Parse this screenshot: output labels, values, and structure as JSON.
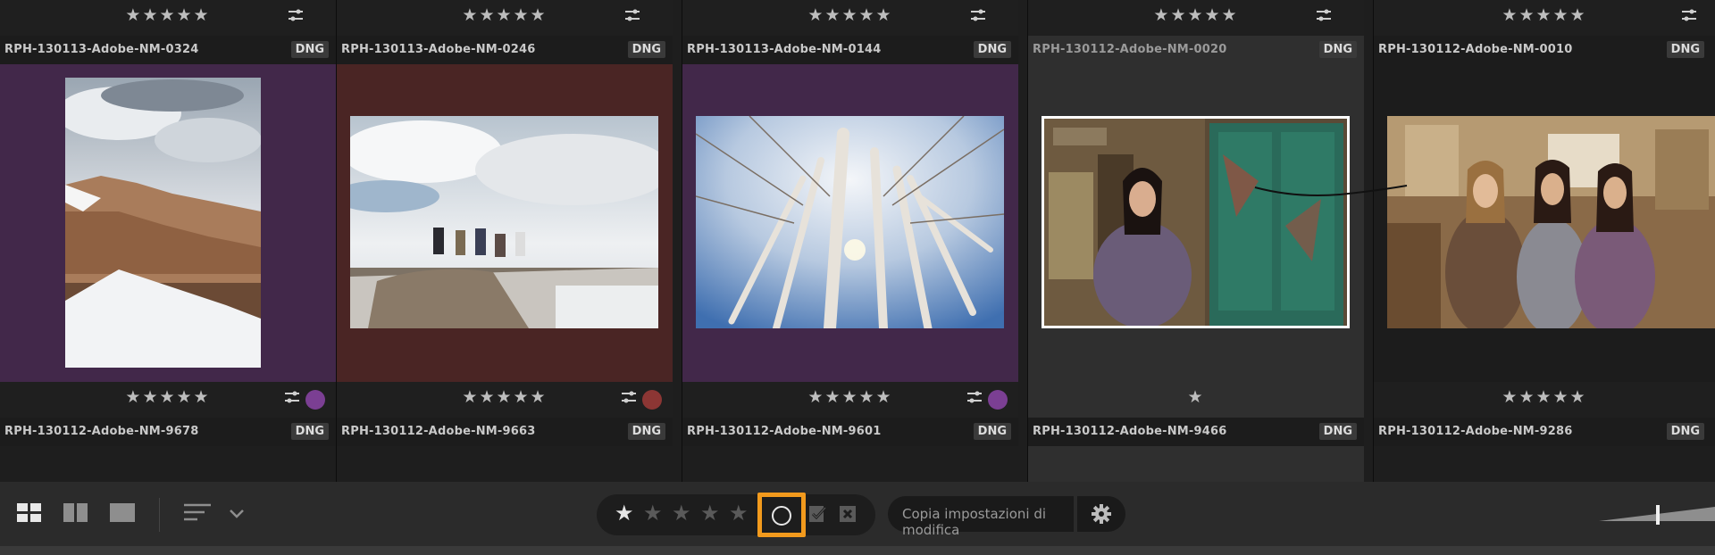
{
  "rows": [
    {
      "cells": [
        {
          "name": "RPH-130113-Adobe-NM-0324",
          "type": "DNG",
          "bg": "#42284a",
          "rating": 5,
          "label_color": "#7b3f93"
        },
        {
          "name": "RPH-130113-Adobe-NM-0246",
          "type": "DNG",
          "bg": "#4a2524",
          "rating": 5,
          "label_color": "#8c3634"
        },
        {
          "name": "RPH-130113-Adobe-NM-0144",
          "type": "DNG",
          "bg": "#42284a",
          "rating": 5,
          "label_color": "#7b3f93"
        },
        {
          "name": "RPH-130112-Adobe-NM-0020",
          "type": "DNG",
          "bg": "#2f2f2f",
          "rating": 1,
          "label_color": ""
        },
        {
          "name": "RPH-130112-Adobe-NM-0010",
          "type": "DNG",
          "bg": "#1c1c1c",
          "rating": 5,
          "label_color": ""
        }
      ]
    },
    {
      "cells": [
        {
          "name": "RPH-130112-Adobe-NM-9678",
          "type": "DNG"
        },
        {
          "name": "RPH-130112-Adobe-NM-9663",
          "type": "DNG"
        },
        {
          "name": "RPH-130112-Adobe-NM-9601",
          "type": "DNG"
        },
        {
          "name": "RPH-130112-Adobe-NM-9466",
          "type": "DNG"
        },
        {
          "name": "RPH-130112-Adobe-NM-9286",
          "type": "DNG"
        }
      ]
    }
  ],
  "top_ratings": [
    "★★★★★",
    "★★★★★",
    "★★★★★",
    "★★★★★",
    "★★★★★"
  ],
  "cell_ratings": [
    "★★★★★",
    "★★★★★",
    "★★★★★",
    "★",
    "★★★★★"
  ],
  "toolbar": {
    "view_icons": [
      "grid-view-icon",
      "compare-view-icon",
      "single-view-icon"
    ],
    "sort_icon": "sort-icon",
    "rating_filter": [
      "★",
      "★",
      "★",
      "★",
      "★"
    ],
    "unflagged_icon": "circle-icon",
    "picked_icon": "flag-check-icon",
    "rejected_icon": "flag-x-icon",
    "copy_settings_label": "Copia impostazioni di modifica",
    "settings_icon": "gear-icon",
    "accent": "#f29a1d"
  }
}
